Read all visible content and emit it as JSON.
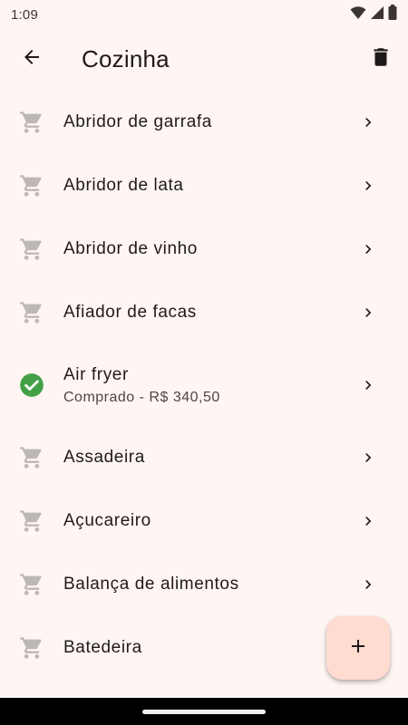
{
  "status_bar": {
    "time": "1:09"
  },
  "app_bar": {
    "title": "Cozinha",
    "back_icon": "arrow-back-icon",
    "delete_icon": "trash-icon"
  },
  "colors": {
    "background": "#fff6f3",
    "cart_icon": "#bdb8b6",
    "check_icon": "#43a047",
    "fab_background": "#ffdbd0"
  },
  "items": [
    {
      "title": "Abridor de garrafa",
      "subtitle": "",
      "status": "pending",
      "icon": "cart-icon"
    },
    {
      "title": "Abridor de lata",
      "subtitle": "",
      "status": "pending",
      "icon": "cart-icon"
    },
    {
      "title": "Abridor de vinho",
      "subtitle": "",
      "status": "pending",
      "icon": "cart-icon"
    },
    {
      "title": "Afiador de facas",
      "subtitle": "",
      "status": "pending",
      "icon": "cart-icon"
    },
    {
      "title": "Air fryer",
      "subtitle": "Comprado - R$ 340,50",
      "status": "bought",
      "icon": "check-circle-icon"
    },
    {
      "title": "Assadeira",
      "subtitle": "",
      "status": "pending",
      "icon": "cart-icon"
    },
    {
      "title": "Açucareiro",
      "subtitle": "",
      "status": "pending",
      "icon": "cart-icon"
    },
    {
      "title": "Balança de alimentos",
      "subtitle": "",
      "status": "pending",
      "icon": "cart-icon"
    },
    {
      "title": "Batedeira",
      "subtitle": "",
      "status": "pending",
      "icon": "cart-icon"
    }
  ],
  "fab": {
    "icon": "plus-icon"
  }
}
